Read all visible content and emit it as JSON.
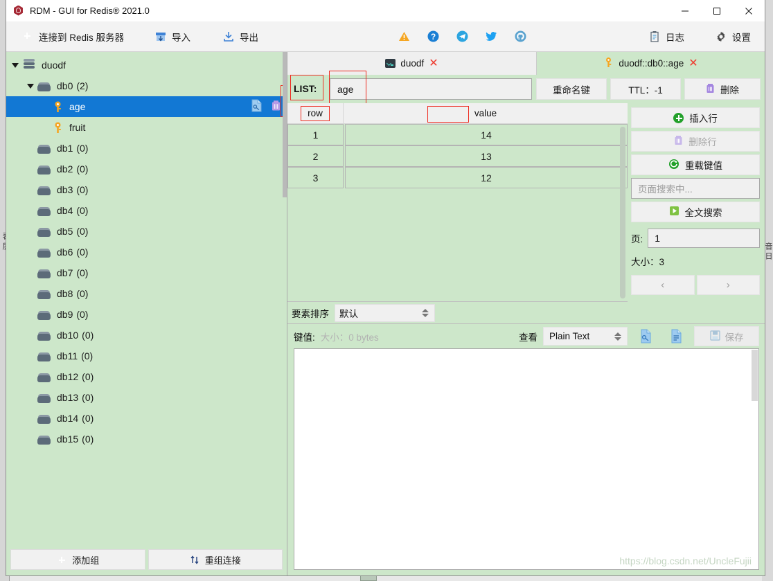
{
  "window": {
    "title": "RDM - GUI for Redis® 2021.0",
    "app_icon": "redis-hexagon-icon",
    "minimize": "minimize-icon",
    "maximize": "maximize-icon",
    "close": "close-icon"
  },
  "toolbar": {
    "connect_label": "连接到 Redis 服务器",
    "import_label": "导入",
    "export_label": "导出",
    "social": [
      "warning-icon",
      "help-icon",
      "telegram-icon",
      "twitter-icon",
      "github-icon"
    ],
    "log_label": "日志",
    "settings_label": "设置"
  },
  "sidebar": {
    "tree": [
      {
        "label": "duodf",
        "count": "",
        "depth": 0,
        "type": "server",
        "expanded": true,
        "selected": false
      },
      {
        "label": "db0",
        "count": "(2)",
        "depth": 1,
        "type": "database",
        "expanded": true,
        "selected": false
      },
      {
        "label": "age",
        "count": "",
        "depth": 2,
        "type": "key",
        "expanded": false,
        "selected": true
      },
      {
        "label": "fruit",
        "count": "",
        "depth": 2,
        "type": "key",
        "expanded": false,
        "selected": false
      },
      {
        "label": "db1",
        "count": "(0)",
        "depth": 1,
        "type": "database",
        "expanded": false,
        "selected": false
      },
      {
        "label": "db2",
        "count": "(0)",
        "depth": 1,
        "type": "database",
        "expanded": false,
        "selected": false
      },
      {
        "label": "db3",
        "count": "(0)",
        "depth": 1,
        "type": "database",
        "expanded": false,
        "selected": false
      },
      {
        "label": "db4",
        "count": "(0)",
        "depth": 1,
        "type": "database",
        "expanded": false,
        "selected": false
      },
      {
        "label": "db5",
        "count": "(0)",
        "depth": 1,
        "type": "database",
        "expanded": false,
        "selected": false
      },
      {
        "label": "db6",
        "count": "(0)",
        "depth": 1,
        "type": "database",
        "expanded": false,
        "selected": false
      },
      {
        "label": "db7",
        "count": "(0)",
        "depth": 1,
        "type": "database",
        "expanded": false,
        "selected": false
      },
      {
        "label": "db8",
        "count": "(0)",
        "depth": 1,
        "type": "database",
        "expanded": false,
        "selected": false
      },
      {
        "label": "db9",
        "count": "(0)",
        "depth": 1,
        "type": "database",
        "expanded": false,
        "selected": false
      },
      {
        "label": "db10",
        "count": "(0)",
        "depth": 1,
        "type": "database",
        "expanded": false,
        "selected": false
      },
      {
        "label": "db11",
        "count": "(0)",
        "depth": 1,
        "type": "database",
        "expanded": false,
        "selected": false
      },
      {
        "label": "db12",
        "count": "(0)",
        "depth": 1,
        "type": "database",
        "expanded": false,
        "selected": false
      },
      {
        "label": "db13",
        "count": "(0)",
        "depth": 1,
        "type": "database",
        "expanded": false,
        "selected": false
      },
      {
        "label": "db14",
        "count": "(0)",
        "depth": 1,
        "type": "database",
        "expanded": false,
        "selected": false
      },
      {
        "label": "db15",
        "count": "(0)",
        "depth": 1,
        "type": "database",
        "expanded": false,
        "selected": false
      }
    ],
    "row_actions": [
      "edit-key-icon",
      "delete-key-icon"
    ],
    "add_group_label": "添加组",
    "reorder_label": "重组连接"
  },
  "tabs": [
    {
      "label": "duodf",
      "icon": "terminal-icon",
      "close": "close-icon",
      "active": false
    },
    {
      "label": "duodf::db0::age",
      "icon": "key-icon",
      "close": "close-icon",
      "active": true
    }
  ],
  "key_header": {
    "type_label": "LIST:",
    "key_name": "age",
    "rename_label": "重命名键",
    "ttl_label": "TTL：-1",
    "delete_label": "删除",
    "delete_icon": "trash-icon"
  },
  "table": {
    "columns": [
      "row",
      "value"
    ],
    "rows": [
      {
        "row": "1",
        "value": "14"
      },
      {
        "row": "2",
        "value": "13"
      },
      {
        "row": "3",
        "value": "12"
      }
    ]
  },
  "sort": {
    "label": "要素排序",
    "value": "默认"
  },
  "side_actions": {
    "insert_row": "插入行",
    "insert_row_icon": "plus-circle-icon",
    "delete_row": "删除行",
    "delete_row_icon": "trash-icon",
    "reload_value": "重载键值",
    "reload_icon": "reload-icon",
    "search_placeholder": "页面搜索中...",
    "full_search": "全文搜索",
    "full_search_icon": "play-icon",
    "page_label": "页:",
    "page_value": "1",
    "size_label": "大小：3",
    "prev": "‹",
    "next": "›"
  },
  "value_bar": {
    "label": "键值:",
    "size": "大小：0 bytes",
    "view_label": "查看",
    "view_value": "Plain Text",
    "icons": [
      "key-document-icon",
      "text-document-icon"
    ],
    "save_label": "保存",
    "save_icon": "floppy-icon"
  },
  "value_editor": {
    "content": "",
    "watermark": "https://blog.csdn.net/UncleFujii"
  },
  "background": {
    "left_text": "表层",
    "right_text": "音日"
  },
  "colors": {
    "green_bg": "#cde7ca",
    "selection_blue": "#1278d4",
    "annotation_red": "#ee2b20",
    "button_gray": "#f0f0f0"
  }
}
